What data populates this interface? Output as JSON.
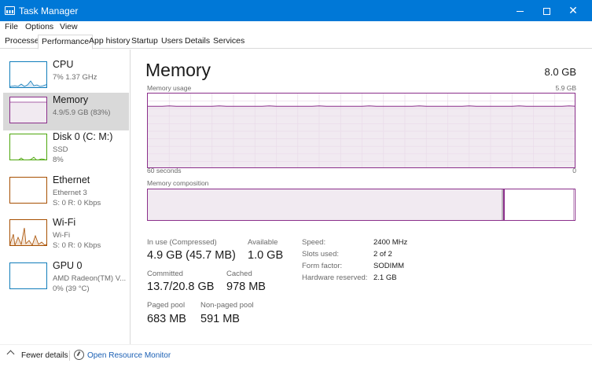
{
  "window": {
    "title": "Task Manager",
    "accent_color": "#0078d7",
    "controls": {
      "minimize": "minimize-icon",
      "maximize": "maximize-icon",
      "close": "✕"
    }
  },
  "menu": [
    "File",
    "Options",
    "View"
  ],
  "tabs": [
    "Processes",
    "Performance",
    "App history",
    "Startup",
    "Users",
    "Details",
    "Services"
  ],
  "active_tab": "Performance",
  "sidebar": {
    "items": [
      {
        "name": "CPU",
        "lines": [
          "7%  1.37 GHz"
        ],
        "color": "#117dbb"
      },
      {
        "name": "Memory",
        "lines": [
          "4.9/5.9 GB (83%)"
        ],
        "color": "#8b2f8b",
        "selected": true
      },
      {
        "name": "Disk 0 (C: M:)",
        "lines": [
          "SSD",
          "8%"
        ],
        "color": "#4da60c"
      },
      {
        "name": "Ethernet",
        "lines": [
          "Ethernet 3",
          "S: 0  R: 0 Kbps"
        ],
        "color": "#a74f01"
      },
      {
        "name": "Wi-Fi",
        "lines": [
          "Wi-Fi",
          "S: 0  R: 0 Kbps"
        ],
        "color": "#a74f01"
      },
      {
        "name": "GPU 0",
        "lines": [
          "AMD Radeon(TM) V...",
          "0% (39 °C)"
        ],
        "color": "#117dbb"
      }
    ]
  },
  "memory": {
    "title": "Memory",
    "total": "8.0 GB",
    "usage_label": "Memory usage",
    "usage_max": "5.9 GB",
    "x_left": "60 seconds",
    "x_right": "0",
    "usage_level": 0.83,
    "composition_label": "Memory composition",
    "composition": {
      "in_use_fraction": 0.83,
      "modified_fraction": 0.004,
      "standby_fraction": 0.162
    },
    "stats": {
      "in_use_label": "In use (Compressed)",
      "in_use_value": "4.9 GB (45.7 MB)",
      "available_label": "Available",
      "available_value": "1.0 GB",
      "committed_label": "Committed",
      "committed_value": "13.7/20.8 GB",
      "cached_label": "Cached",
      "cached_value": "978 MB",
      "paged_label": "Paged pool",
      "paged_value": "683 MB",
      "nonpaged_label": "Non-paged pool",
      "nonpaged_value": "591 MB"
    },
    "details": [
      {
        "label": "Speed:",
        "value": "2400 MHz"
      },
      {
        "label": "Slots used:",
        "value": "2 of 2"
      },
      {
        "label": "Form factor:",
        "value": "SODIMM"
      },
      {
        "label": "Hardware reserved:",
        "value": "2.1 GB"
      }
    ]
  },
  "footer": {
    "fewer_details": "Fewer details",
    "open_resource_monitor": "Open Resource Monitor"
  }
}
